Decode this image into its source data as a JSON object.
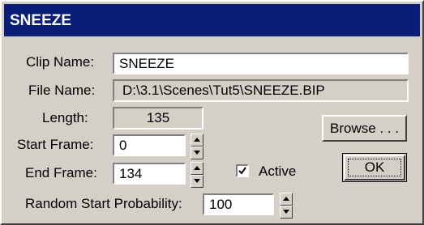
{
  "title": "SNEEZE",
  "clip_name": {
    "label": "Clip Name:",
    "value": "SNEEZE"
  },
  "file_name": {
    "label": "File Name:",
    "value": "D:\\3.1\\Scenes\\Tut5\\SNEEZE.BIP"
  },
  "length": {
    "label": "Length:",
    "value": "135"
  },
  "start_frame": {
    "label": "Start Frame:",
    "value": "0"
  },
  "end_frame": {
    "label": "End Frame:",
    "value": "134"
  },
  "random_start": {
    "label": "Random Start Probability:",
    "value": "100"
  },
  "active": {
    "label": "Active",
    "checked": true
  },
  "buttons": {
    "browse": "Browse . . .",
    "ok": "OK"
  },
  "colors": {
    "titlebar": "#0a1e78",
    "face": "#d4d0c8"
  }
}
